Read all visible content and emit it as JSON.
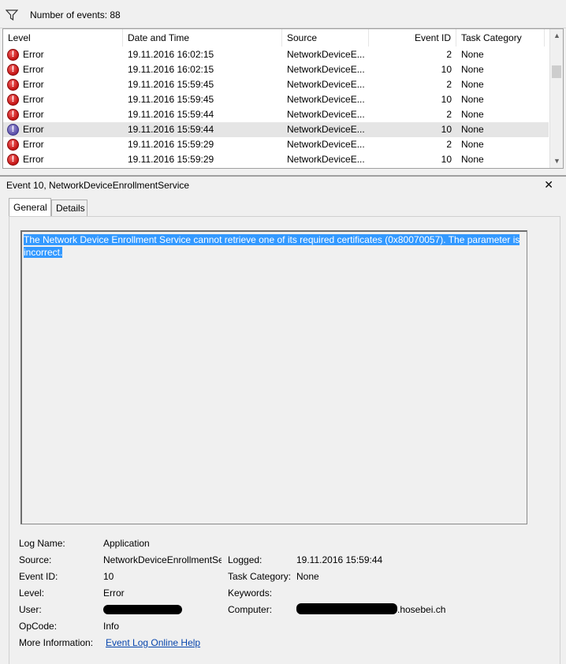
{
  "filter": {
    "icon": "filter-icon",
    "count_text": "Number of events: 88"
  },
  "columns": [
    "Level",
    "Date and Time",
    "Source",
    "Event ID",
    "Task Category"
  ],
  "events": [
    {
      "level": "Error",
      "datetime": "19.11.2016 16:02:15",
      "source": "NetworkDeviceE...",
      "event_id": "2",
      "task": "None"
    },
    {
      "level": "Error",
      "datetime": "19.11.2016 16:02:15",
      "source": "NetworkDeviceE...",
      "event_id": "10",
      "task": "None"
    },
    {
      "level": "Error",
      "datetime": "19.11.2016 15:59:45",
      "source": "NetworkDeviceE...",
      "event_id": "2",
      "task": "None"
    },
    {
      "level": "Error",
      "datetime": "19.11.2016 15:59:45",
      "source": "NetworkDeviceE...",
      "event_id": "10",
      "task": "None"
    },
    {
      "level": "Error",
      "datetime": "19.11.2016 15:59:44",
      "source": "NetworkDeviceE...",
      "event_id": "2",
      "task": "None"
    },
    {
      "level": "Error",
      "datetime": "19.11.2016 15:59:44",
      "source": "NetworkDeviceE...",
      "event_id": "10",
      "task": "None"
    },
    {
      "level": "Error",
      "datetime": "19.11.2016 15:59:29",
      "source": "NetworkDeviceE...",
      "event_id": "2",
      "task": "None"
    },
    {
      "level": "Error",
      "datetime": "19.11.2016 15:59:29",
      "source": "NetworkDeviceE...",
      "event_id": "10",
      "task": "None"
    }
  ],
  "detail": {
    "title": "Event 10, NetworkDeviceEnrollmentService",
    "close_glyph": "✕",
    "tabs": [
      "General",
      "Details"
    ],
    "description_line1": "The Network Device Enrollment Service cannot retrieve one of its required certificates (0x80070057).  The parameter is",
    "description_line2": "incorrect.",
    "props": {
      "log_name_label": "Log Name:",
      "log_name_value": "Application",
      "source_label": "Source:",
      "source_value": "NetworkDeviceEnrollmentSe",
      "logged_label": "Logged:",
      "logged_value": "19.11.2016 15:59:44",
      "event_id_label": "Event ID:",
      "event_id_value": "10",
      "task_category_label": "Task Category:",
      "task_category_value": "None",
      "level_label": "Level:",
      "level_value": "Error",
      "keywords_label": "Keywords:",
      "keywords_value": "",
      "user_label": "User:",
      "user_value": "",
      "computer_label": "Computer:",
      "computer_value": ".hosebei.ch",
      "opcode_label": "OpCode:",
      "opcode_value": "Info",
      "more_info_label": "More Information:",
      "more_info_link": "Event Log Online Help"
    }
  },
  "colors": {
    "error_red": "#c31212",
    "selection_blue": "#3399ff",
    "link_blue": "#0645ad"
  }
}
